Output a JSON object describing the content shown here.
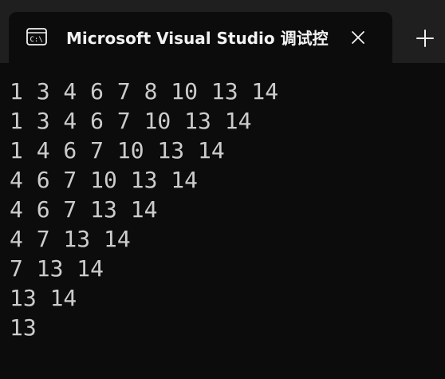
{
  "tab": {
    "title": "Microsoft Visual Studio 调试控",
    "icon": "console-icon",
    "close_icon": "close-icon"
  },
  "new_tab_icon": "plus-icon",
  "colors": {
    "background": "#0c0c0c",
    "titlebar": "#1f1f1f",
    "text": "#cccccc"
  },
  "output": {
    "lines": [
      "1 3 4 6 7 8 10 13 14",
      "1 3 4 6 7 10 13 14",
      "1 4 6 7 10 13 14",
      "4 6 7 10 13 14",
      "4 6 7 13 14",
      "4 7 13 14",
      "7 13 14",
      "13 14",
      "13"
    ]
  }
}
